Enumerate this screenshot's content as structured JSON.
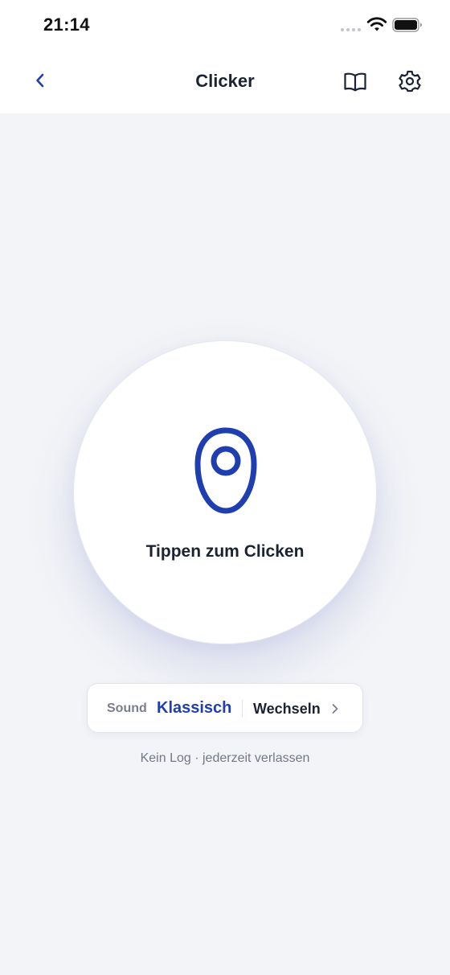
{
  "status_bar": {
    "time": "21:14"
  },
  "nav": {
    "title": "Clicker",
    "back_icon": "chevron-left-icon",
    "book_icon": "book-open-icon",
    "settings_icon": "gear-icon"
  },
  "clicker": {
    "label": "Tippen zum Clicken",
    "icon": "clicker-device-icon"
  },
  "sound": {
    "label": "Sound",
    "value": "Klassisch",
    "switch_label": "Wechseln",
    "switch_icon": "chevron-right-icon"
  },
  "footer": {
    "note": "Kein Log · jederzeit verlassen"
  },
  "colors": {
    "accent": "#1f3fb0",
    "background": "#f3f4f7",
    "text": "#1b2333"
  }
}
